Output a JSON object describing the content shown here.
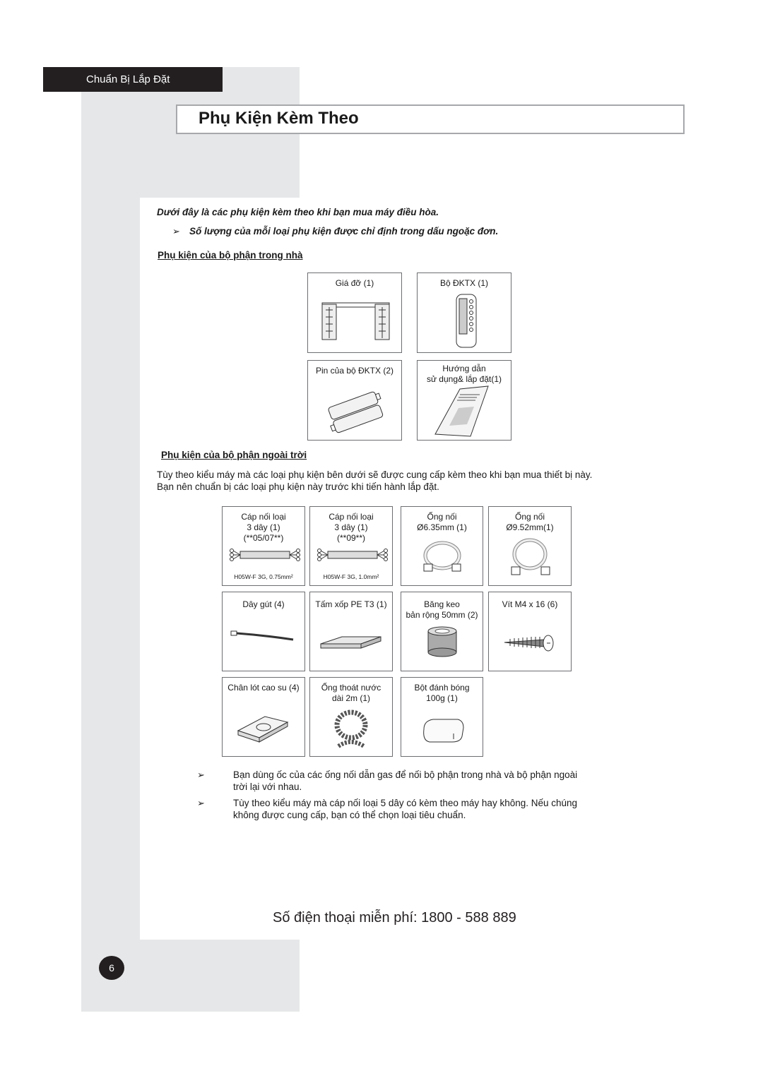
{
  "header": {
    "section_tab": "Chuẩn Bị Lắp Đặt",
    "title": "Phụ Kiện Kèm Theo"
  },
  "intro": {
    "line1": "Dưới đây là các phụ kiện kèm theo khi bạn mua máy điều hòa.",
    "arrow": "➢",
    "line2": "Số lượng của mỗi loại phụ kiện được chỉ định trong dấu ngoặc đơn."
  },
  "indoor": {
    "heading": "Phụ kiện của bộ phận trong nhà",
    "items": [
      {
        "label": "Giá đỡ (1)",
        "icon": "bracket-icon"
      },
      {
        "label": "Bộ ĐKTX (1)",
        "icon": "remote-control-icon"
      },
      {
        "label": "Pin của bộ ĐKTX (2)",
        "icon": "batteries-icon"
      },
      {
        "label": "Hướng dẫn\nsử dụng& lắp đặt(1)",
        "icon": "manual-icon"
      }
    ]
  },
  "outdoor": {
    "heading": "Phụ kiện của bộ phận ngoài trời",
    "description_line1": "Tùy theo kiểu máy mà các loại phụ kiện bên dưới sẽ được cung cấp kèm theo khi bạn mua thiết bị này.",
    "description_line2": "Bạn nên chuẩn bị các loại phụ kiện này trước khi tiến hành lắp đặt.",
    "items": [
      {
        "label": "Cáp nối loại\n3 dây (1)\n(**05/07**)",
        "spec": "H05W-F 3G, 0.75mm²",
        "icon": "cable-icon"
      },
      {
        "label": "Cáp nối loại\n3 dây (1)\n(**09**)",
        "spec": "H05W-F 3G, 1.0mm²",
        "icon": "cable-icon"
      },
      {
        "label": "Ống nối\nØ6.35mm (1)",
        "icon": "pipe-icon"
      },
      {
        "label": "Ống nối\nØ9.52mm(1)",
        "icon": "pipe-icon"
      },
      {
        "label": "Dây gút (4)",
        "icon": "cable-tie-icon"
      },
      {
        "label": "Tấm xốp PE T3 (1)",
        "icon": "foam-sheet-icon"
      },
      {
        "label": "Băng keo\nbản rộng 50mm (2)",
        "icon": "tape-roll-icon"
      },
      {
        "label": "Vít M4 x 16 (6)",
        "icon": "screw-icon"
      },
      {
        "label": "Chân lót cao su (4)",
        "icon": "rubber-foot-icon"
      },
      {
        "label": "Ống thoát nước\ndài 2m (1)",
        "icon": "drain-hose-icon"
      },
      {
        "label": "Bột đánh bóng\n100g (1)",
        "icon": "putty-icon"
      }
    ]
  },
  "notes": [
    {
      "arrow": "➢",
      "line1": "Bạn dùng ốc của các ống nối dẫn gas để nối bộ phận trong nhà và bộ phận ngoài",
      "line2": "trời lại với nhau."
    },
    {
      "arrow": "➢",
      "line1": "Tùy theo kiểu máy mà cáp nối loại 5 dây có kèm theo máy hay không. Nếu chúng",
      "line2": "không được cung cấp, bạn có thể chọn loại tiêu chuẩn."
    }
  ],
  "footer": {
    "phone": "Số điện thoại miễn phí: 1800 - 588 889",
    "page_number": "6"
  }
}
